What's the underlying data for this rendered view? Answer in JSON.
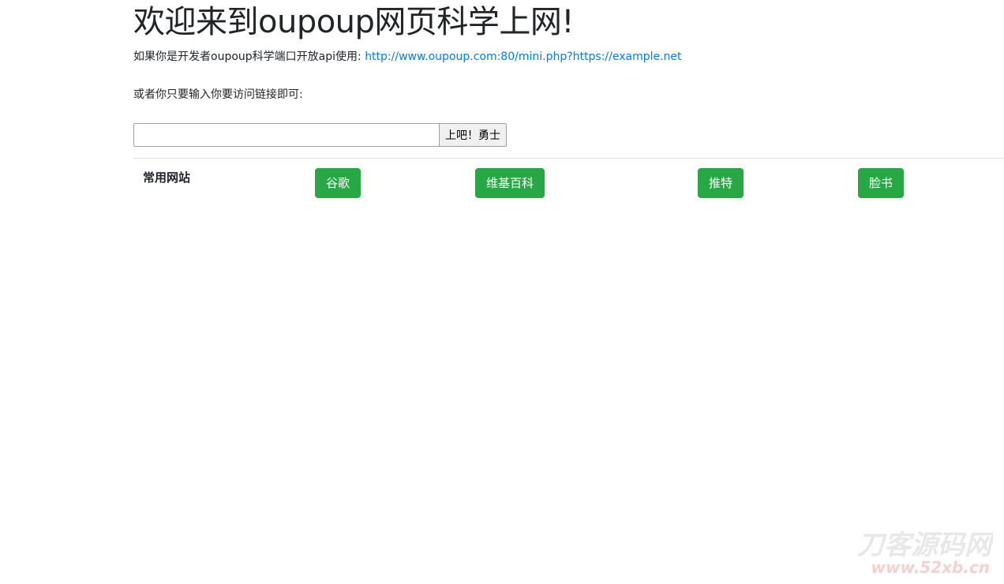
{
  "header": {
    "title": "欢迎来到oupoup网页科学上网!"
  },
  "api": {
    "text": "如果你是开发者oupoup科学端口开放api使用: ",
    "link": "http://www.oupoup.com:80/mini.php?https://example.net"
  },
  "prompt": {
    "text": "或者你只要输入你要访问链接即可:"
  },
  "form": {
    "input_value": "",
    "button_label": "上吧！勇士"
  },
  "sites": {
    "label": "常用网站",
    "buttons": [
      {
        "label": "谷歌"
      },
      {
        "label": "维基百科"
      },
      {
        "label": "推特"
      },
      {
        "label": "脸书"
      }
    ]
  },
  "watermark": {
    "title": "刀客源码网",
    "url": "www.52xb.cn"
  },
  "colors": {
    "link": "#007bff",
    "success": "#28a745"
  }
}
